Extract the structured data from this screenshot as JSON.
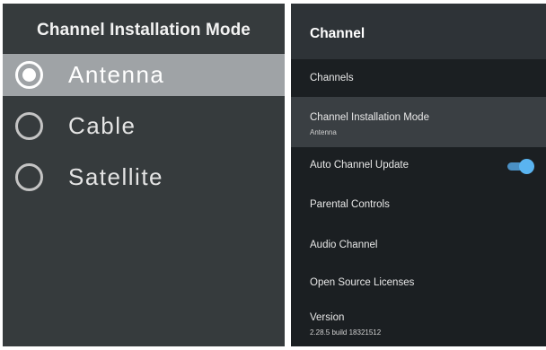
{
  "mode_panel": {
    "title": "Channel Installation Mode",
    "options": [
      {
        "label": "Antenna",
        "selected": true
      },
      {
        "label": "Cable",
        "selected": false
      },
      {
        "label": "Satellite",
        "selected": false
      }
    ]
  },
  "channel_panel": {
    "title": "Channel",
    "items": [
      {
        "label": "Channels"
      },
      {
        "label": "Channel Installation Mode",
        "value": "Antenna",
        "focused": true
      },
      {
        "label": "Auto Channel Update",
        "toggle": true,
        "toggle_on": true
      },
      {
        "label": "Parental Controls"
      },
      {
        "label": "Audio Channel"
      },
      {
        "label": "Open Source Licenses"
      },
      {
        "label": "Version",
        "value": "2.28.5 build 18321512"
      }
    ]
  },
  "colors": {
    "left_bg": "#363b3d",
    "selected_bg": "#9fa3a6",
    "right_bg": "#1b1f22",
    "header_bg": "#2e3337",
    "focused_bg": "#3a3f43",
    "toggle_accent": "#5ab4f0"
  },
  "icons": {
    "radio_selected": "radio-selected-icon",
    "radio_unselected": "radio-unselected-icon"
  }
}
